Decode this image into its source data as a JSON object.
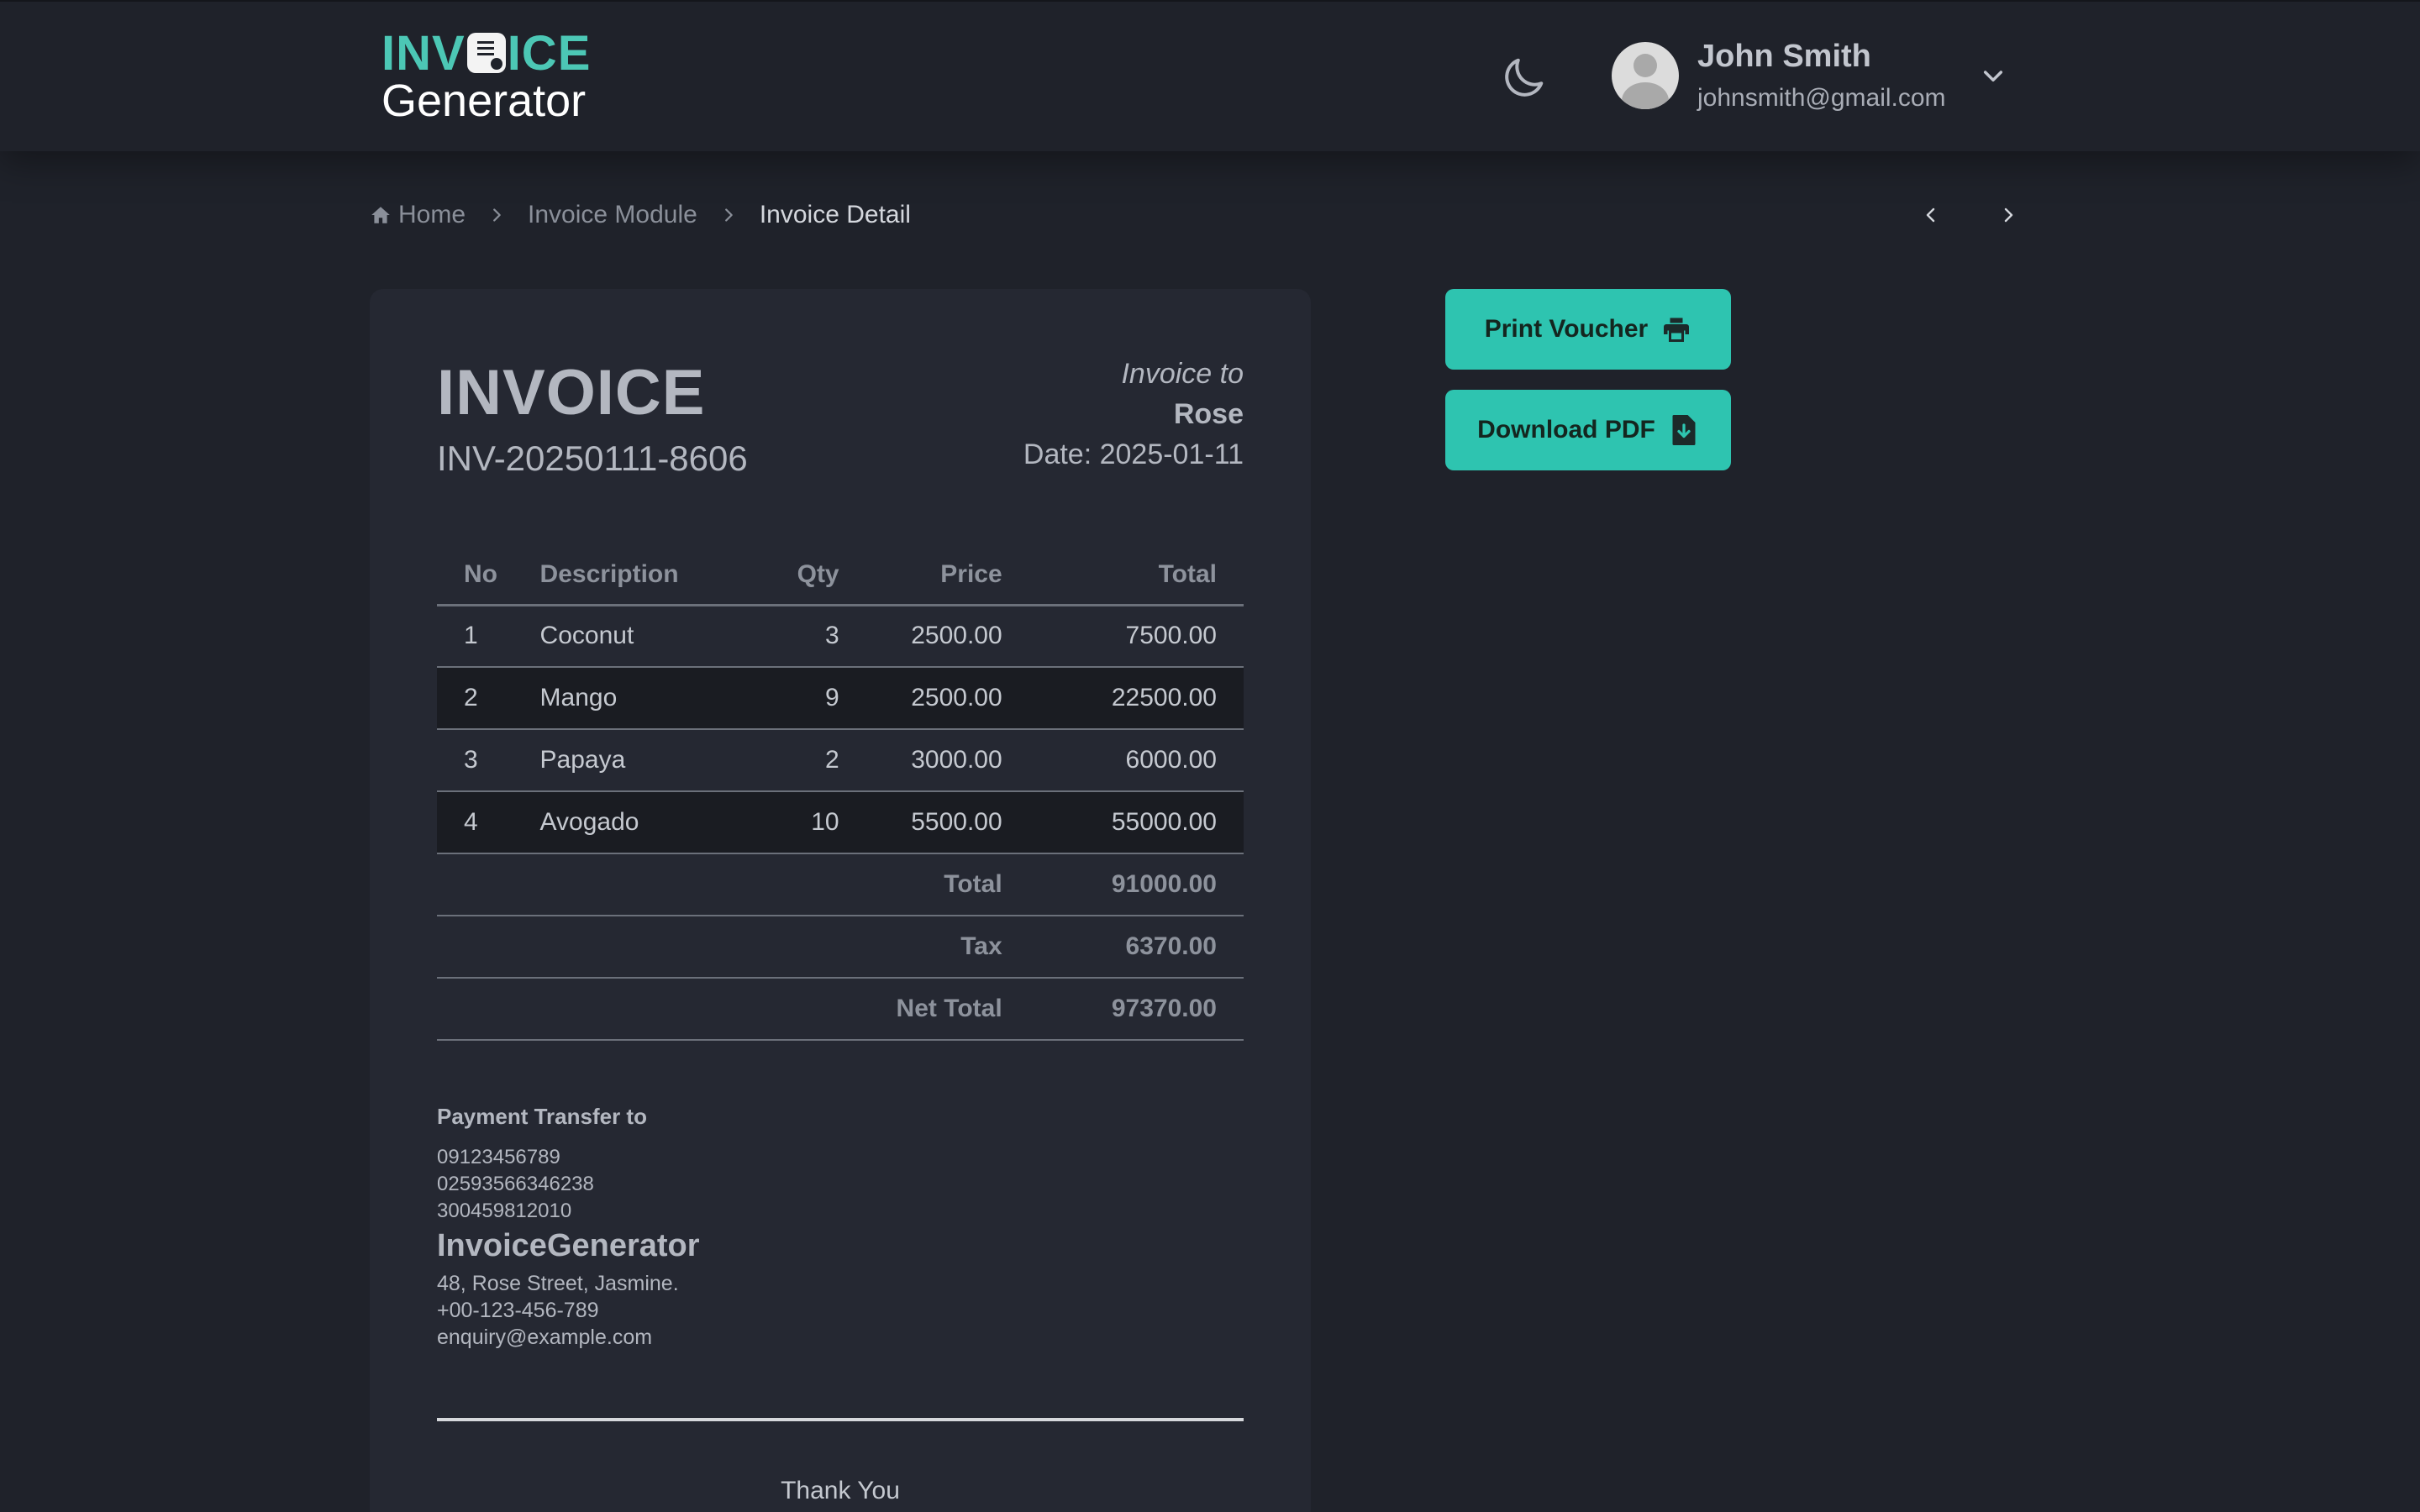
{
  "header": {
    "logo_top_left": "INV",
    "logo_top_right": "ICE",
    "logo_bottom": "Generator",
    "user_name": "John Smith",
    "user_email": "johnsmith@gmail.com"
  },
  "breadcrumb": {
    "home": "Home",
    "module": "Invoice Module",
    "current": "Invoice Detail"
  },
  "actions": {
    "print_label": "Print Voucher",
    "pdf_label": "Download PDF"
  },
  "invoice": {
    "title": "INVOICE",
    "number": "INV-20250111-8606",
    "to_label": "Invoice to",
    "to_name": "Rose",
    "date": "Date: 2025-01-11",
    "columns": [
      "No",
      "Description",
      "Qty",
      "Price",
      "Total"
    ],
    "rows": [
      {
        "no": "1",
        "description": "Coconut",
        "qty": "3",
        "price": "2500.00",
        "total": "7500.00"
      },
      {
        "no": "2",
        "description": "Mango",
        "qty": "9",
        "price": "2500.00",
        "total": "22500.00"
      },
      {
        "no": "3",
        "description": "Papaya",
        "qty": "2",
        "price": "3000.00",
        "total": "6000.00"
      },
      {
        "no": "4",
        "description": "Avogado",
        "qty": "10",
        "price": "5500.00",
        "total": "55000.00"
      }
    ],
    "summary": [
      {
        "label": "Total",
        "value": "91000.00"
      },
      {
        "label": "Tax",
        "value": "6370.00"
      },
      {
        "label": "Net Total",
        "value": "97370.00"
      }
    ],
    "payment_title": "Payment Transfer to",
    "payment_accounts": [
      "09123456789",
      "02593566346238",
      "300459812010"
    ],
    "company_name": "InvoiceGenerator",
    "company_lines": [
      "48, Rose Street, Jasmine.",
      "+00-123-456-789",
      "enquiry@example.com"
    ],
    "thanks": "Thank You"
  },
  "colors": {
    "background": "#1f222a",
    "card": "#252832",
    "accent": "#2ec4b0",
    "logo_accent": "#4cc7b5"
  },
  "icons": {
    "theme_toggle": "moon-icon",
    "user_menu": "chevron-down-icon",
    "home": "home-icon",
    "separator": "chevron-right-icon",
    "pager_prev": "chevron-left-icon",
    "pager_next": "chevron-right-icon",
    "print": "printer-icon",
    "pdf": "file-download-icon"
  }
}
